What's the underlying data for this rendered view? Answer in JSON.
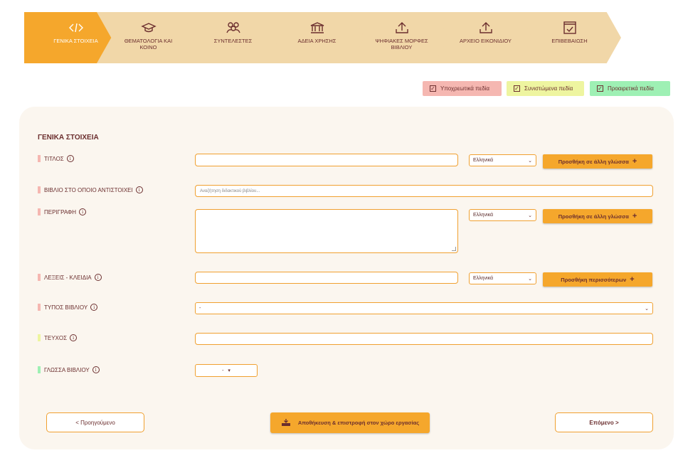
{
  "steps": [
    {
      "label": "ΓΕΝΙΚΑ ΣΤΟΙΧΕΙΑ",
      "icon": "code-icon",
      "active": true
    },
    {
      "label": "ΘΕΜΑΤΟΛΟΓΙΑ ΚΑΙ ΚΟΙΝΟ",
      "icon": "graduation-cap-icon"
    },
    {
      "label": "ΣΥΝΤΕΛΕΣΤΕΣ",
      "icon": "users-icon"
    },
    {
      "label": "ΑΔΕΙΑ ΧΡΗΣΗΣ",
      "icon": "institution-icon"
    },
    {
      "label": "ΨΗΦΙΑΚΕΣ ΜΟΡΦΕΣ ΒΙΒΛΙΟΥ",
      "icon": "upload-icon"
    },
    {
      "label": "ΑΡΧΕΙΟ ΕΙΚΟΝΙΔΙΟΥ",
      "icon": "upload-icon"
    },
    {
      "label": "ΕΠΙΒΕΒΑΙΩΣΗ",
      "icon": "checkbox-icon"
    }
  ],
  "legend": {
    "required": "Υποχρεωτικά πεδία",
    "recommended": "Συνιστώμενα πεδία",
    "optional": "Προαιρετικά πεδία"
  },
  "colors": {
    "accent": "#f5a72c",
    "step_inactive": "#f1d7a8",
    "required": "#f5b7b1",
    "recommended": "#eef5a0",
    "optional": "#9ef0b4",
    "text": "#6b2e2e"
  },
  "section_title": "ΓΕΝΙΚΑ ΣΤΟΙΧΕΙΑ",
  "fields": {
    "title": {
      "label": "ΤΙΤΛΟΣ",
      "language": "Ελληνικά",
      "button": "Προσθήκη σε άλλη γλώσσα"
    },
    "book": {
      "label": "ΒΙΒΛΙΟ ΣΤΟ ΟΠΟΙΟ ΑΝΤΙΣΤΟΙΧΕΙ",
      "placeholder": "Αναζήτηση διδακτικού βιβλίου..."
    },
    "description": {
      "label": "ΠΕΡΙΓΡΑΦΗ",
      "language": "Ελληνικά",
      "button": "Προσθήκη σε άλλη γλώσσα"
    },
    "keywords": {
      "label": "ΛΕΞΕΙΣ - ΚΛΕΙΔΙΑ",
      "language": "Ελληνικά",
      "button": "Προσθήκη περισσότερων"
    },
    "book_type": {
      "label": "ΤΥΠΟΣ ΒΙΒΛΙΟΥ",
      "value": "-"
    },
    "issue": {
      "label": "ΤΕΥΧΟΣ"
    },
    "book_language": {
      "label": "ΓΛΩΣΣΑ ΒΙΒΛΙΟΥ",
      "value": "-"
    }
  },
  "footer": {
    "prev": "< Προηγούμενο",
    "save": "Αποθήκευση & επιστροφή στον χώρο εργασίας",
    "next": "Επόμενο >"
  }
}
